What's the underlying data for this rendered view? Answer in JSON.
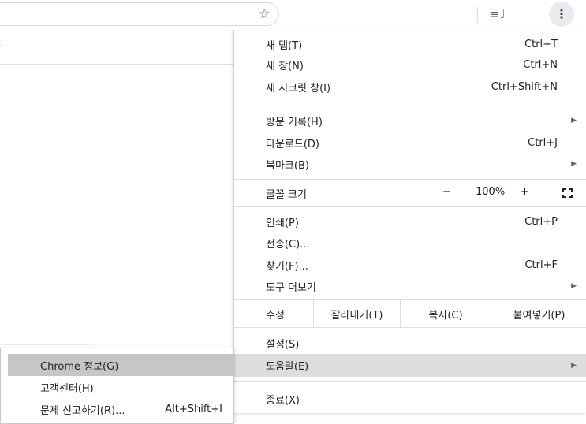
{
  "toolbar": {
    "star_icon": "☆",
    "media_icon": "≡♩",
    "menu_icon": "⋮"
  },
  "page_panel": {
    "dot": "."
  },
  "main_menu": {
    "new_tab": {
      "label": "새 탭(T)",
      "shortcut": "Ctrl+T"
    },
    "new_window": {
      "label": "새 창(N)",
      "shortcut": "Ctrl+N"
    },
    "new_incognito": {
      "label": "새 시크릿 창(I)",
      "shortcut": "Ctrl+Shift+N"
    },
    "history": {
      "label": "방문 기록(H)"
    },
    "downloads": {
      "label": "다운로드(D)",
      "shortcut": "Ctrl+J"
    },
    "bookmarks": {
      "label": "북마크(B)"
    },
    "zoom": {
      "label": "글꼴 크기",
      "minus": "−",
      "value": "100%",
      "plus": "+"
    },
    "print": {
      "label": "인쇄(P)",
      "shortcut": "Ctrl+P"
    },
    "cast": {
      "label": "전송(C)..."
    },
    "find": {
      "label": "찾기(F)...",
      "shortcut": "Ctrl+F"
    },
    "more_tools": {
      "label": "도구 더보기"
    },
    "edit": {
      "label": "수정",
      "cut": "잘라내기(T)",
      "copy": "복사(C)",
      "paste": "붙여넣기(P)"
    },
    "settings": {
      "label": "설정(S)"
    },
    "help": {
      "label": "도움말(E)"
    },
    "exit": {
      "label": "종료(X)"
    },
    "submenu_arrow": "▶"
  },
  "help_submenu": {
    "about": {
      "label": "Chrome 정보(G)"
    },
    "help_center": {
      "label": "고객센터(H)"
    },
    "report": {
      "label": "문제 신고하기(R)...",
      "shortcut": "Alt+Shift+I"
    }
  }
}
